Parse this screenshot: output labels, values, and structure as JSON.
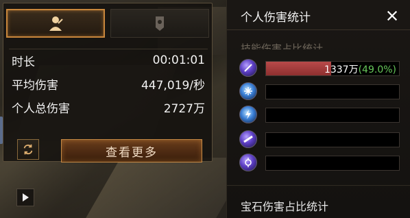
{
  "tabs": {
    "personal_icon": "player-icon",
    "team_icon": "team-banner-icon"
  },
  "stats": {
    "duration": {
      "label": "时长",
      "value": "00:01:01"
    },
    "avg_damage": {
      "label": "平均伤害",
      "value": "447,019/秒"
    },
    "total_damage": {
      "label": "个人总伤害",
      "value": "2727万"
    }
  },
  "buttons": {
    "refresh_icon": "refresh-icon",
    "view_more": "查看更多",
    "play_icon": "play-icon"
  },
  "panel": {
    "title": "个人伤害统计",
    "close_icon": "close-icon",
    "skill_section_title": "技能伤害占比统计",
    "gem_section_title": "宝石伤害占比统计"
  },
  "skills": [
    {
      "icon": "skill-purple-slash-icon",
      "value": "1337万",
      "percent": "(49.0%)",
      "fill": 0.49
    },
    {
      "icon": "skill-frost-icon",
      "value": "",
      "percent": "",
      "fill": 0
    },
    {
      "icon": "skill-lightning-icon",
      "value": "",
      "percent": "",
      "fill": 0
    },
    {
      "icon": "skill-violet-beam-icon",
      "value": "",
      "percent": "",
      "fill": 0
    },
    {
      "icon": "skill-arcane-icon",
      "value": "",
      "percent": "",
      "fill": 0
    }
  ],
  "colors": {
    "accent": "#c9873c",
    "bar_fill": "#b84a4a",
    "percent_text": "#67c75a"
  }
}
